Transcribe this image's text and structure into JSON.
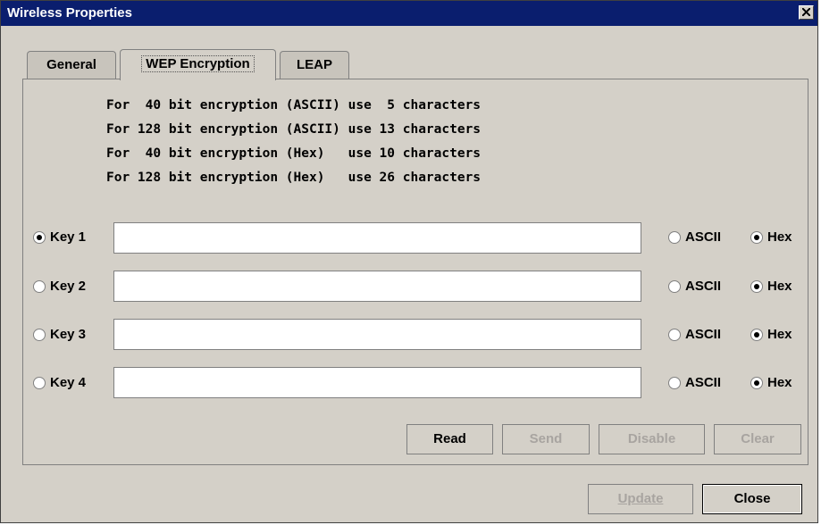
{
  "window": {
    "title": "Wireless Properties"
  },
  "tabs": [
    {
      "label": "General",
      "active": false
    },
    {
      "label": "WEP Encryption",
      "active": true
    },
    {
      "label": "LEAP",
      "active": false
    }
  ],
  "notes": [
    "For  40 bit encryption (ASCII) use  5 characters",
    "For 128 bit encryption (ASCII) use 13 characters",
    "For  40 bit encryption (Hex)   use 10 characters",
    "For 128 bit encryption (Hex)   use 26 characters"
  ],
  "keys": [
    {
      "label": "Key 1",
      "selected": true,
      "value": "",
      "format": "Hex"
    },
    {
      "label": "Key 2",
      "selected": false,
      "value": "",
      "format": "Hex"
    },
    {
      "label": "Key 3",
      "selected": false,
      "value": "",
      "format": "Hex"
    },
    {
      "label": "Key 4",
      "selected": false,
      "value": "",
      "format": "Hex"
    }
  ],
  "format_labels": {
    "ascii": "ASCII",
    "hex": "Hex"
  },
  "panel_buttons": {
    "read": "Read",
    "send": "Send",
    "disable": "Disable",
    "clear": "Clear"
  },
  "footer_buttons": {
    "update": "Update",
    "close": "Close"
  }
}
